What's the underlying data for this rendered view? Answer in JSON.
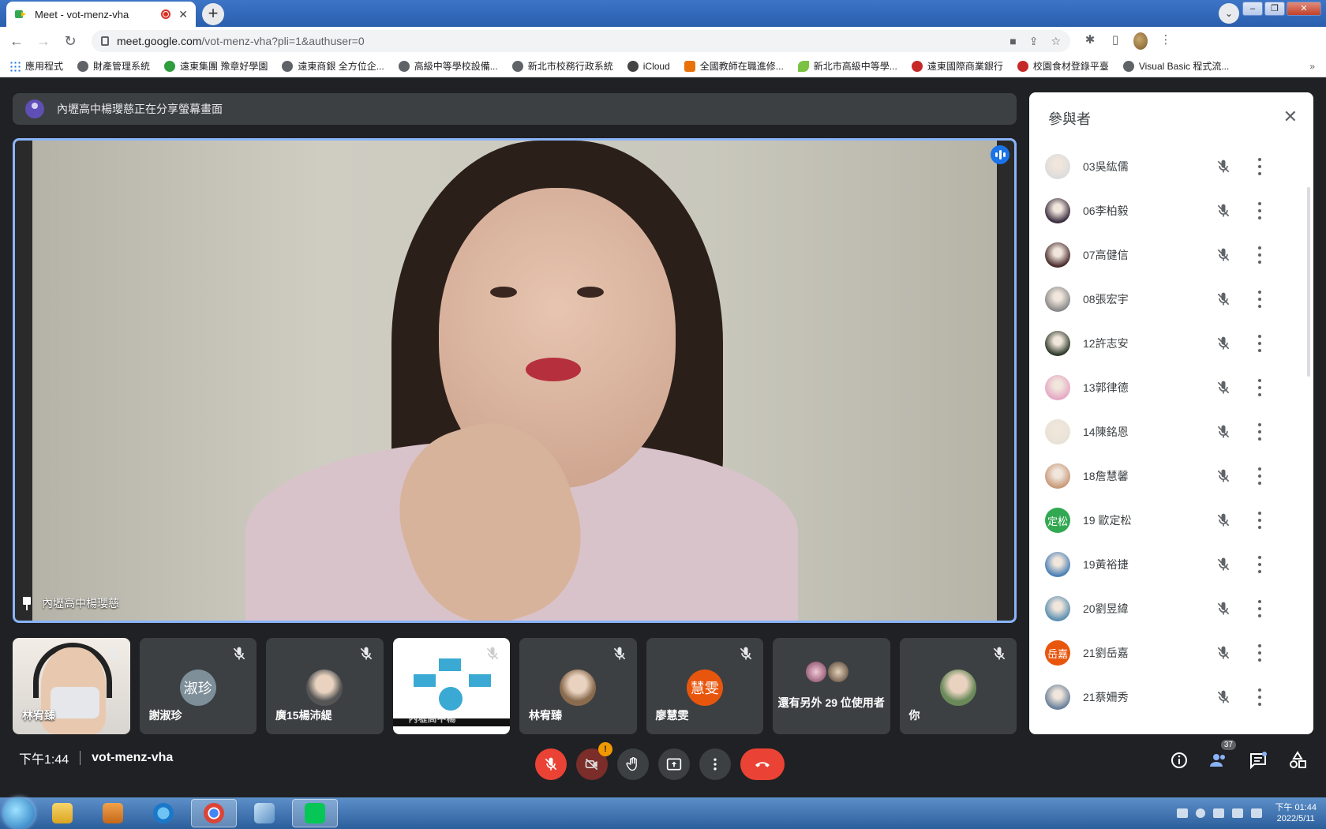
{
  "browser": {
    "tab_title": "Meet - vot-menz-vha",
    "tab_close": "✕",
    "new_tab": "+",
    "url_host": "meet.google.com",
    "url_path": "/vot-menz-vha?pli=1&authuser=0",
    "bookmarks": [
      {
        "label": "應用程式",
        "icon": "apps-grid-icon"
      },
      {
        "label": "財產管理系統",
        "icon": "globe-icon"
      },
      {
        "label": "遠東集團 豫章好學園",
        "icon": "green-circle-icon"
      },
      {
        "label": "遠東商銀 全方位企...",
        "icon": "globe-icon"
      },
      {
        "label": "高級中等學校設備...",
        "icon": "globe-icon"
      },
      {
        "label": "新北市校務行政系統",
        "icon": "globe-icon"
      },
      {
        "label": "iCloud",
        "icon": "apple-icon"
      },
      {
        "label": "全國教師在職進修...",
        "icon": "orange-badge-icon"
      },
      {
        "label": "新北市高級中等學...",
        "icon": "leaf-icon"
      },
      {
        "label": "遠東國際商業銀行",
        "icon": "red-logo-icon"
      },
      {
        "label": "校園食材登錄平臺",
        "icon": "red-logo-icon"
      },
      {
        "label": "Visual Basic 程式流...",
        "icon": "globe-icon"
      }
    ],
    "bookmarks_more": "»"
  },
  "meet": {
    "presenting_banner": "內壢高中楊瓔慈正在分享螢幕畫面",
    "main_speaker_label": "內壢高中楊瓔慈",
    "tiles": [
      {
        "name": "林宥臻",
        "kind": "camera"
      },
      {
        "name": "謝淑珍",
        "kind": "initials",
        "initials": "淑珍",
        "color": "#7e8f9a"
      },
      {
        "name": "廣15楊沛緹",
        "kind": "photo",
        "color": "#555"
      },
      {
        "name": "內壢高中楊",
        "kind": "slide"
      },
      {
        "name": "林宥臻",
        "kind": "photo",
        "color": "#8a6b4e"
      },
      {
        "name": "廖慧雯",
        "kind": "initials",
        "initials": "慧雯",
        "color": "#e8560d"
      },
      {
        "name": "還有另外 29 位使用者",
        "kind": "more"
      },
      {
        "name": "你",
        "kind": "photo",
        "color": "#6b8a5a"
      }
    ],
    "time": "下午1:44",
    "meeting_code": "vot-menz-vha",
    "camera_badge": "!",
    "participant_count": "37",
    "colors": {
      "accent": "#1a73e8",
      "danger": "#ea4335",
      "bg": "#202124"
    }
  },
  "panel": {
    "title": "參與者",
    "close": "✕",
    "participants": [
      {
        "name": "03吳紘儒",
        "avatar_color": "#dcdcdc",
        "initials": ""
      },
      {
        "name": "06李柏毅",
        "avatar_color": "#3a2d3f",
        "initials": ""
      },
      {
        "name": "07高健信",
        "avatar_color": "#4a2c2c",
        "initials": ""
      },
      {
        "name": "08張宏宇",
        "avatar_color": "#8a8a8a",
        "initials": ""
      },
      {
        "name": "12許志安",
        "avatar_color": "#2f3b2a",
        "initials": ""
      },
      {
        "name": "13郭律德",
        "avatar_color": "#e6a8c5",
        "initials": ""
      },
      {
        "name": "14陳銘恩",
        "avatar_color": "#e8e2d6",
        "initials": ""
      },
      {
        "name": "18詹慧馨",
        "avatar_color": "#c89a7a",
        "initials": ""
      },
      {
        "name": "19 歐定松",
        "avatar_color": "#33a852",
        "initials": "定松"
      },
      {
        "name": "19黃裕捷",
        "avatar_color": "#4a7fb5",
        "initials": ""
      },
      {
        "name": "20劉昱緯",
        "avatar_color": "#5b8fb0",
        "initials": ""
      },
      {
        "name": "21劉岳嘉",
        "avatar_color": "#e8560d",
        "initials": "岳嘉"
      },
      {
        "name": "21蔡姍秀",
        "avatar_color": "#6a7f9a",
        "initials": ""
      }
    ]
  },
  "taskbar": {
    "time": "下午 01:44",
    "date": "2022/5/11",
    "apps": [
      "explorer-icon",
      "media-player-icon",
      "internet-explorer-icon",
      "chrome-icon",
      "paint-icon",
      "line-icon"
    ]
  }
}
